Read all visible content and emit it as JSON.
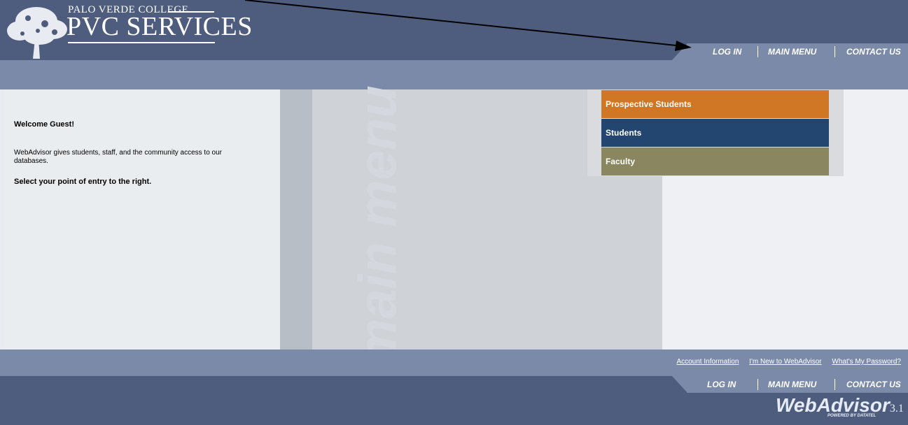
{
  "header": {
    "college": "PALO VERDE COLLEGE",
    "services": "PVC SERVICES"
  },
  "nav": [
    {
      "label": "Log In"
    },
    {
      "label": "Main Menu"
    },
    {
      "label": "Contact Us"
    }
  ],
  "watermark": "main menu",
  "welcome": {
    "heading": "Welcome Guest!",
    "description": "WebAdvisor gives students, staff, and the community access to our databases.",
    "instruction": "Select your point of entry to the right."
  },
  "menu": [
    {
      "label": "Prospective Students",
      "color": "#cf7725"
    },
    {
      "label": "Students",
      "color": "#22466f"
    },
    {
      "label": "Faculty",
      "color": "#898660"
    }
  ],
  "footer_links": [
    "Account Information",
    "I'm New to WebAdvisor",
    "What's My Password?"
  ],
  "brand": {
    "name": "WebAdvisor",
    "version": "3.1",
    "powered": "POWERED BY DATATEL"
  }
}
